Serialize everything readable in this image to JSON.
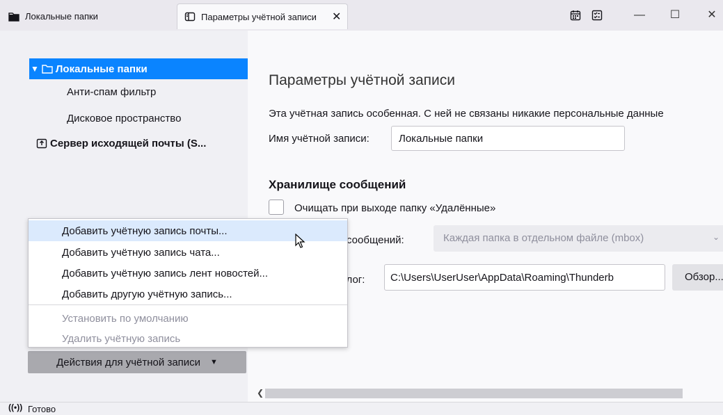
{
  "tabs": [
    {
      "label": "Локальные папки",
      "icon": "folder-icon"
    },
    {
      "label": "Параметры учётной записи",
      "icon": "account-settings-icon",
      "close": "✕"
    }
  ],
  "window_controls": {
    "minimize": "—",
    "maximize": "☐",
    "close": "✕"
  },
  "toolbar_icons": [
    "calendar-icon",
    "tasks-icon"
  ],
  "sidebar": {
    "items": [
      {
        "label": "Локальные папки",
        "selected": true
      },
      {
        "label": "Анти-спам фильтр"
      },
      {
        "label": "Дисковое пространство"
      },
      {
        "label": "Сервер исходящей почты (S..."
      }
    ],
    "actions_button": "Действия для учётной записи"
  },
  "main": {
    "title": "Параметры учётной записи",
    "description": "Эта учётная запись особенная. С ней не связаны никакие персональные данные",
    "account_name_label": "Имя учётной записи:",
    "account_name_value": "Локальные папки",
    "storage_heading": "Хранилище сообщений",
    "empty_trash_label": "Очищать при выходе папку «Удалённые»",
    "store_type_label": "Тип хранилища сообщений:",
    "store_type_value": "Каждая папка в отдельном файле (mbox)",
    "local_dir_label": "Локальный каталог:",
    "local_dir_value": "C:\\Users\\UserUser\\AppData\\Roaming\\Thunderb",
    "browse_button": "Обзор..."
  },
  "menu": {
    "items": [
      {
        "label": "Добавить учётную запись почты...",
        "enabled": true,
        "highlighted": true
      },
      {
        "label": "Добавить учётную запись чата...",
        "enabled": true
      },
      {
        "label": "Добавить учётную запись лент новостей...",
        "enabled": true
      },
      {
        "label": "Добавить другую учётную запись...",
        "enabled": true
      },
      {
        "label": "Установить по умолчанию",
        "enabled": false
      },
      {
        "label": "Удалить учётную запись",
        "enabled": false
      }
    ]
  },
  "statusbar": {
    "icon": "((•))",
    "text": "Готово"
  },
  "colors": {
    "accent": "#0a84ff",
    "menu_highlight": "#dbeafd",
    "sidebar_bg": "#f0f0f4"
  }
}
